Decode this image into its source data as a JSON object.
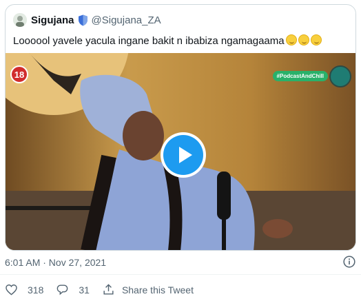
{
  "quoted_tweet": {
    "display_name": "Sigujana",
    "handle": "@Sigujana_ZA",
    "text": "Loooool yavele yacula ingane bakit n ibabiza ngamagaama",
    "emoji_count": 3
  },
  "media": {
    "age_badge": "18",
    "show_tag": "#PodcastAndChill",
    "play_icon": "play-icon"
  },
  "tweet": {
    "timestamp": "6:01 AM · Nov 27, 2021"
  },
  "actions": {
    "like_count": "318",
    "reply_count": "31",
    "share_label": "Share this Tweet"
  },
  "colors": {
    "accent": "#1d9bf0",
    "muted_text": "#536471",
    "border": "#cfd9de"
  }
}
